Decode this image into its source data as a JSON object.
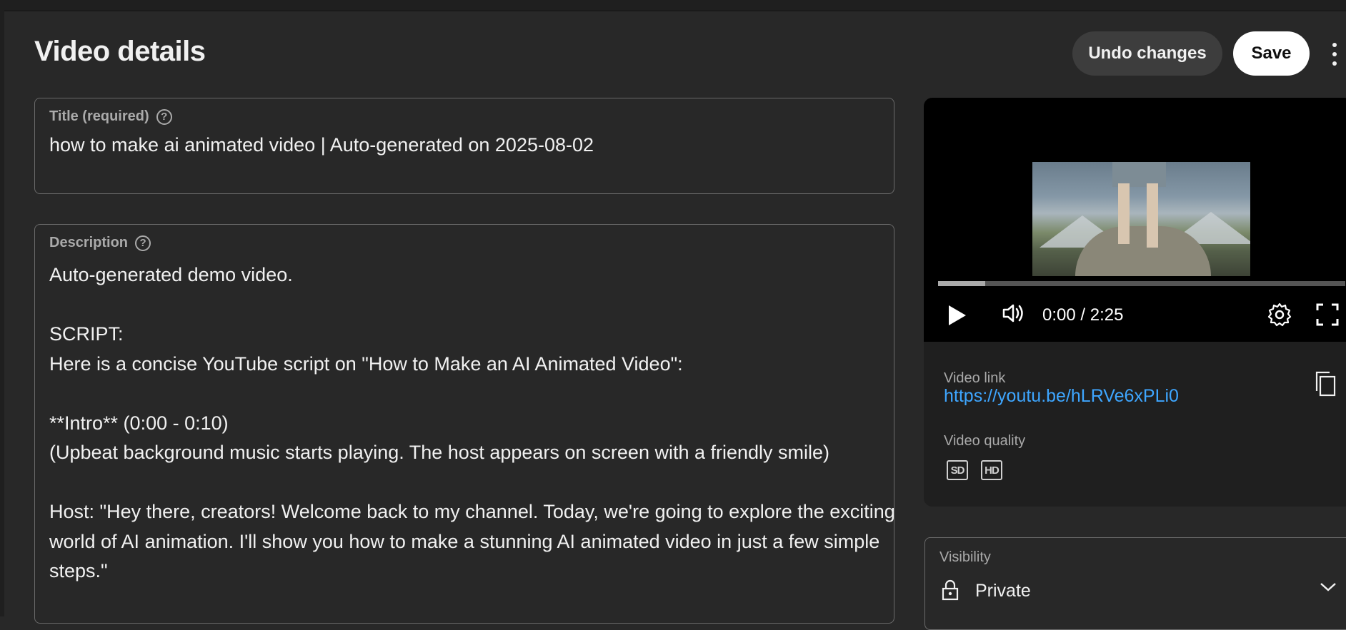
{
  "header": {
    "page_title": "Video details",
    "undo_label": "Undo changes",
    "save_label": "Save",
    "more_icon": "more-vert-icon"
  },
  "title_field": {
    "label": "Title (required)",
    "value": "how to make ai animated video | Auto-generated on 2025-08-02"
  },
  "description_field": {
    "label": "Description",
    "lines": [
      "Auto-generated demo video.",
      "",
      "SCRIPT:",
      "Here is a concise YouTube script on \"How to Make an AI Animated Video\":",
      "",
      "**Intro** (0:00 - 0:10)",
      "(Upbeat background music starts playing. The host appears on screen with a friendly smile)",
      "",
      "Host: \"Hey there, creators! Welcome back to my channel. Today, we're going to explore the exciting",
      "world of AI animation. I'll show you how to make a stunning AI animated video in just a few simple",
      "steps.\""
    ]
  },
  "player": {
    "time": "0:00 / 2:25",
    "progress_fraction": 0.115,
    "icons": [
      "play-icon",
      "volume-icon",
      "settings-gear-icon",
      "fullscreen-icon"
    ]
  },
  "video_info": {
    "link_label": "Video link",
    "link_url": "https://youtu.be/hLRVe6xPLi0",
    "quality_label": "Video quality",
    "qualities": [
      "SD",
      "HD"
    ]
  },
  "visibility": {
    "label": "Visibility",
    "value": "Private"
  },
  "colors": {
    "background": "#282828",
    "link": "#3ea6ff",
    "save_button": "#ffffff"
  }
}
